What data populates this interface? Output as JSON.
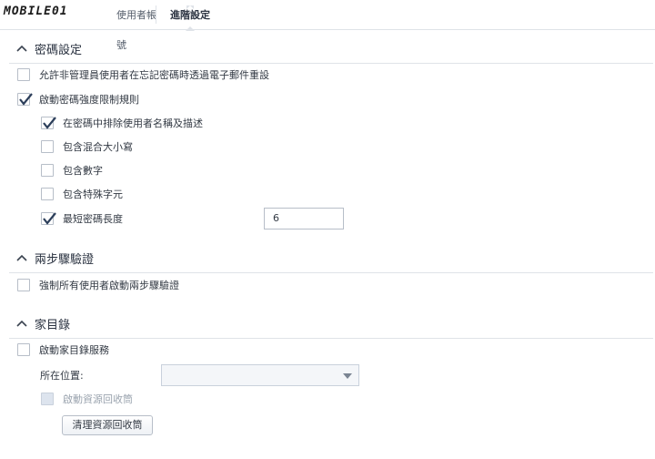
{
  "watermark": {
    "text": "MOBILE01"
  },
  "tabs": [
    {
      "label": "使用者帳號",
      "active": false
    },
    {
      "label": "進階設定",
      "active": true
    }
  ],
  "sections": {
    "password": {
      "title": "密碼設定",
      "allow_reset": {
        "label": "允許非管理員使用者在忘記密碼時透過電子郵件重設",
        "checked": false
      },
      "enforce_rules": {
        "label": "啟動密碼強度限制規則",
        "checked": true
      },
      "exclude_name": {
        "label": "在密碼中排除使用者名稱及描述",
        "checked": true
      },
      "mixed_case": {
        "label": "包含混合大小寫",
        "checked": false
      },
      "digits": {
        "label": "包含數字",
        "checked": false
      },
      "special_chars": {
        "label": "包含特殊字元",
        "checked": false
      },
      "min_length": {
        "label": "最短密碼長度",
        "checked": true,
        "value": "6"
      }
    },
    "two_step": {
      "title": "兩步驟驗證",
      "enforce_all": {
        "label": "強制所有使用者啟動兩步驟驗證",
        "checked": false
      }
    },
    "home": {
      "title": "家目錄",
      "enable_service": {
        "label": "啟動家目錄服務",
        "checked": false
      },
      "location_label": "所在位置:",
      "location_value": "",
      "recycle_bin": {
        "label": "啟動資源回收筒",
        "checked": false
      },
      "clear_button": "清理資源回收筒"
    }
  },
  "colors": {
    "checkmark": "#2c3e5a",
    "border": "#b7bec8",
    "divider": "#dfe3e8"
  },
  "icons": {
    "section_toggle": "chevron-up-icon",
    "checkbox_mark": "checkmark-icon",
    "dropdown": "caret-down-icon"
  }
}
